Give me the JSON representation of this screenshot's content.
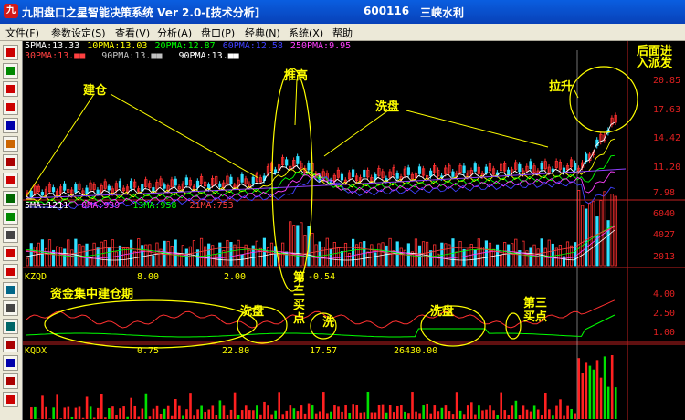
{
  "window": {
    "title": "九阳盘口之星智能决策系统 Ver 2.0-[技术分析]",
    "stock_code": "600116",
    "stock_name": "三峡水利"
  },
  "menu": [
    "文件(F)",
    "参数设定(S)",
    "查看(V)",
    "分析(A)",
    "盘口(P)",
    "经典(N)",
    "系统(X)",
    "帮助"
  ],
  "toolbar_icons": [
    "kline-icon",
    "trend-icon",
    "bar-icon",
    "candle-icon",
    "wave-icon",
    "ma-icon",
    "volume-icon",
    "flag-icon",
    "grid-icon",
    "table-icon",
    "calc-icon",
    "news-icon",
    "f10-icon",
    "pad-icon",
    "zoom-icon",
    "map-icon",
    "stat-icon",
    "list-icon",
    "report-icon",
    "keypad-icon"
  ],
  "price_panel": {
    "legend_row1": [
      {
        "text": "5PMA:13.33",
        "color": "#ffffff"
      },
      {
        "text": "10PMA:13.03",
        "color": "#ffff00"
      },
      {
        "text": "20PMA:12.87",
        "color": "#00ff00"
      },
      {
        "text": "60PMA:12.58",
        "color": "#4040ff"
      },
      {
        "text": "250PMA:9.95",
        "color": "#ff40ff"
      }
    ],
    "legend_row2": [
      {
        "text": "30PMA:13.■■",
        "color": "#ff4040"
      },
      {
        "text": "90PMA:13.■■",
        "color": "#c0c0c0"
      },
      {
        "text": "90PMA:13.■■",
        "color": "#ffffff"
      }
    ],
    "axis": [
      "20.85",
      "17.63",
      "14.42",
      "11.20",
      "7.98"
    ]
  },
  "volume_panel": {
    "legend": [
      {
        "text": "5MA:1211",
        "color": "#ffffff"
      },
      {
        "text": "8MA:939",
        "color": "#ff40ff"
      },
      {
        "text": "13MA:958",
        "color": "#00ff00"
      },
      {
        "text": "21MA:753",
        "color": "#ff4040"
      }
    ],
    "axis": [
      "6040",
      "4027",
      "2013"
    ]
  },
  "kzqd_panel": {
    "name": "KZQD",
    "values": [
      "8.00",
      "2.00",
      "-0.54"
    ],
    "axis": [
      "4.00",
      "2.50",
      "1.00"
    ]
  },
  "kqdx_panel": {
    "name": "KQDX",
    "values": [
      "0.75",
      "22.80",
      "17.57",
      "26430.00"
    ]
  },
  "annotations": {
    "jiancang": "建仓",
    "tuigao": "推高",
    "xipan1": "洗盘",
    "lasheng": "拉升",
    "houmian": "后面进",
    "paifa": "入派发",
    "zijin": "资金集中建仓期",
    "xipan2": "洗盘",
    "xi": "洗",
    "xipan3": "洗盘",
    "disan1": "第三买点",
    "disan2": "第三买点"
  }
}
